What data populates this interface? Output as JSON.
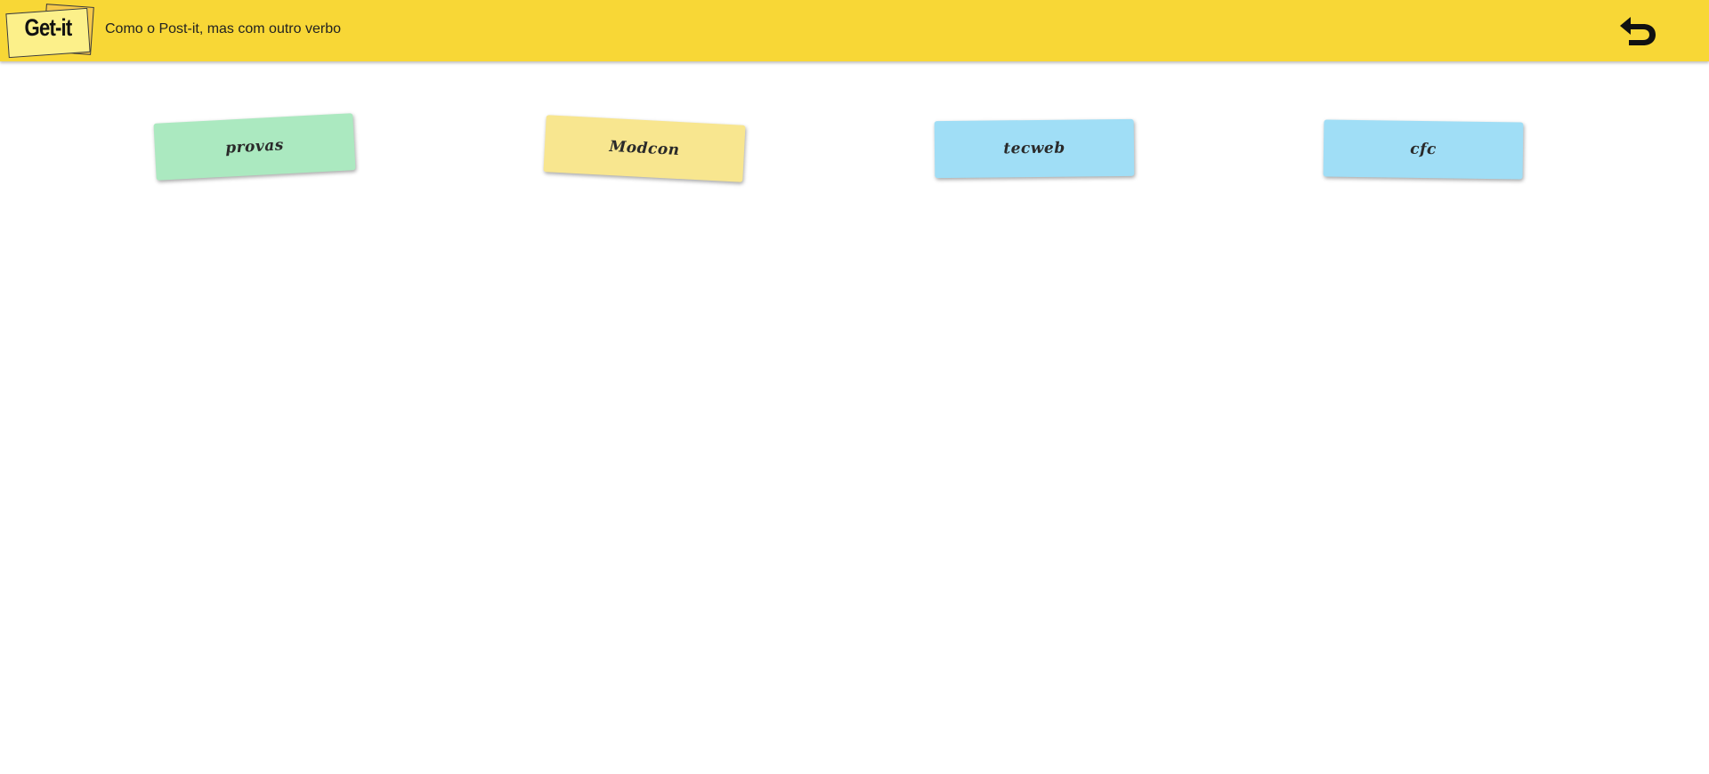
{
  "header": {
    "logo_text": "Get-it",
    "tagline": "Como o Post-it, mas com outro verbo",
    "back_icon": "undo-arrow-icon",
    "background_color": "#f8d736"
  },
  "notes": [
    {
      "label": "provas",
      "color": "#abe9c0"
    },
    {
      "label": "Modcon",
      "color": "#f8e68f"
    },
    {
      "label": "tecweb",
      "color": "#a0def6"
    },
    {
      "label": "cfc",
      "color": "#a0def6"
    }
  ]
}
